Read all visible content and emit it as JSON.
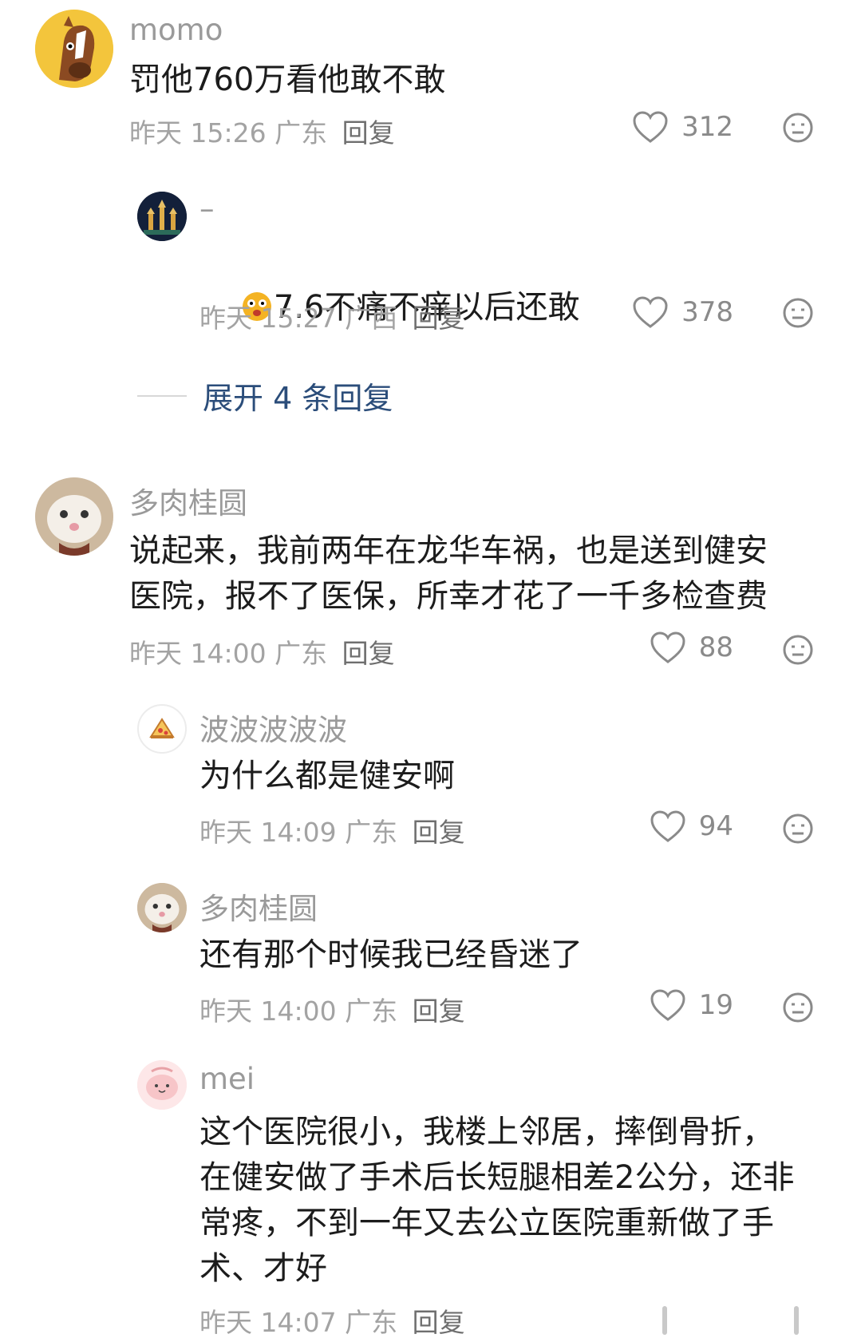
{
  "comments": [
    {
      "username": "momo",
      "text": "罚他760万看他敢不敢",
      "time": "昨天 15:26",
      "location": "广东",
      "reply_label": "回复",
      "likes": "312",
      "avatar_icon": "horse-avatar"
    },
    {
      "username": "–",
      "text": "7.6不痛不痒以后还敢",
      "emoji_icon": "shocked-face-emoji",
      "time": "昨天 15:27",
      "location": "广西",
      "reply_label": "回复",
      "likes": "378",
      "avatar_icon": "castle-night-avatar"
    }
  ],
  "expand_replies": "展开 4 条回复",
  "comments2": [
    {
      "username": "多肉桂圆",
      "text": "说起来，我前两年在龙华车祸，也是送到健安\n医院，报不了医保，所幸才花了一千多检查费",
      "time": "昨天 14:00",
      "location": "广东",
      "reply_label": "回复",
      "likes": "88",
      "avatar_icon": "cat-avatar"
    },
    {
      "username": "波波波波波",
      "text": "为什么都是健安啊",
      "time": "昨天 14:09",
      "location": "广东",
      "reply_label": "回复",
      "likes": "94",
      "avatar_icon": "pizza-avatar"
    },
    {
      "username": "多肉桂圆",
      "text": "还有那个时候我已经昏迷了",
      "time": "昨天 14:00",
      "location": "广东",
      "reply_label": "回复",
      "likes": "19",
      "avatar_icon": "cat-avatar"
    },
    {
      "username": "mei",
      "text": "这个医院很小，我楼上邻居，摔倒骨折，\n在健安做了手术后长短腿相差2公分，还非\n常疼，不到一年又去公立医院重新做了手\n术、才好",
      "time": "昨天 14:07",
      "location": "广东",
      "reply_label": "回复",
      "avatar_icon": "pink-blob-avatar"
    }
  ]
}
